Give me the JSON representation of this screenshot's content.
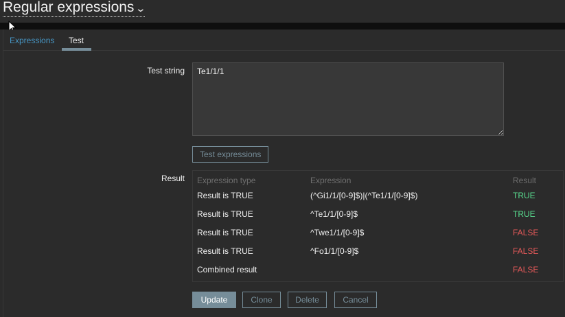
{
  "header": {
    "title": "Regular expressions"
  },
  "tabs": [
    {
      "label": "Expressions"
    },
    {
      "label": "Test"
    }
  ],
  "form": {
    "test_string_label": "Test string",
    "test_string_value": "Te1/1/1",
    "test_button": "Test expressions",
    "result_label": "Result"
  },
  "result_table": {
    "headers": [
      "Expression type",
      "Expression",
      "Result"
    ],
    "rows": [
      {
        "type": "Result is TRUE",
        "expression": "(^Gi1/1/[0-9]$)|(^Te1/1/[0-9]$)",
        "result": "TRUE"
      },
      {
        "type": "Result is TRUE",
        "expression": "^Te1/1/[0-9]$",
        "result": "TRUE"
      },
      {
        "type": "Result is TRUE",
        "expression": "^Twe1/1/[0-9]$",
        "result": "FALSE"
      },
      {
        "type": "Result is TRUE",
        "expression": "^Fo1/1/[0-9]$",
        "result": "FALSE"
      }
    ],
    "combined": {
      "label": "Combined result",
      "result": "FALSE"
    }
  },
  "buttons": {
    "update": "Update",
    "clone": "Clone",
    "delete": "Delete",
    "cancel": "Cancel"
  },
  "colors": {
    "true": "#59db8f",
    "false": "#e45959",
    "accent": "#768d99",
    "link": "#4796c4"
  }
}
